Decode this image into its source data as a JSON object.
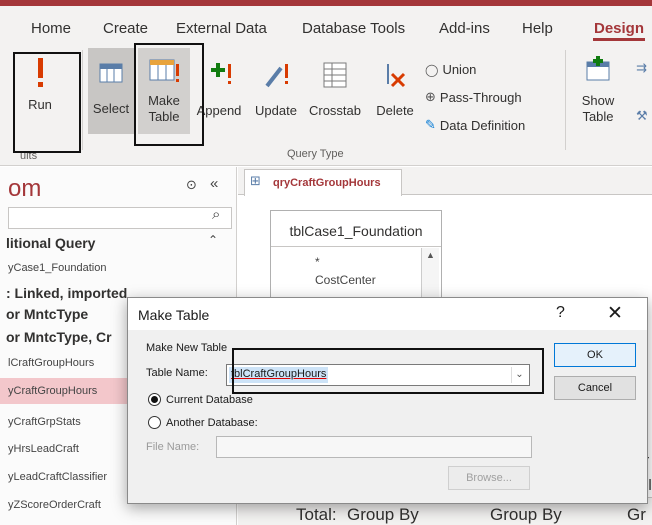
{
  "ribbon_tabs": [
    "Home",
    "Create",
    "External Data",
    "Database Tools",
    "Add-ins",
    "Help",
    "Design"
  ],
  "ribbon": {
    "run": "Run",
    "select": "Select",
    "make_table_1": "Make",
    "make_table_2": "Table",
    "append": "Append",
    "update": "Update",
    "crosstab": "Crosstab",
    "delete": "Delete",
    "union": "Union",
    "pass_through": "Pass-Through",
    "data_definition": "Data Definition",
    "show_table_1": "Show",
    "show_table_2": "Table",
    "results_group": "ults",
    "query_type_group": "Query Type"
  },
  "nav": {
    "title": "om",
    "headers": [
      "litional Query",
      ": Linked, imported",
      "or MntcType",
      "or MntcType, Cr"
    ],
    "items": [
      "yCase1_Foundation",
      "lCraftGroupHours",
      "yCraftGroupHours",
      "yCraftGrpStats",
      "yHrsLeadCraft",
      "yLeadCraftClassifier",
      "yZScoreOrderCraft"
    ]
  },
  "query": {
    "tab": "qryCraftGroupHours",
    "table_name": "tblCase1_Foundation",
    "fields": [
      "*",
      "CostCenter"
    ],
    "total_label": "Total:",
    "group_by_1": "Group By",
    "group_by_2": "Group By",
    "group_by_3": "Gr",
    "side_1": "Ir",
    "side_2": "ol"
  },
  "dialog": {
    "title": "Make Table",
    "help": "?",
    "close": "✕",
    "section": "Make New Table",
    "table_name_label": "Table Name:",
    "table_name_value": "tblCraftGroupHours",
    "current_db": "Current Database",
    "another_db": "Another Database:",
    "file_name_label": "File Name:",
    "ok": "OK",
    "cancel": "Cancel",
    "browse": "Browse..."
  },
  "colors": {
    "accent": "#a4373a",
    "dialog_bg": "#f0f0f0",
    "selection": "#cde3f7"
  }
}
